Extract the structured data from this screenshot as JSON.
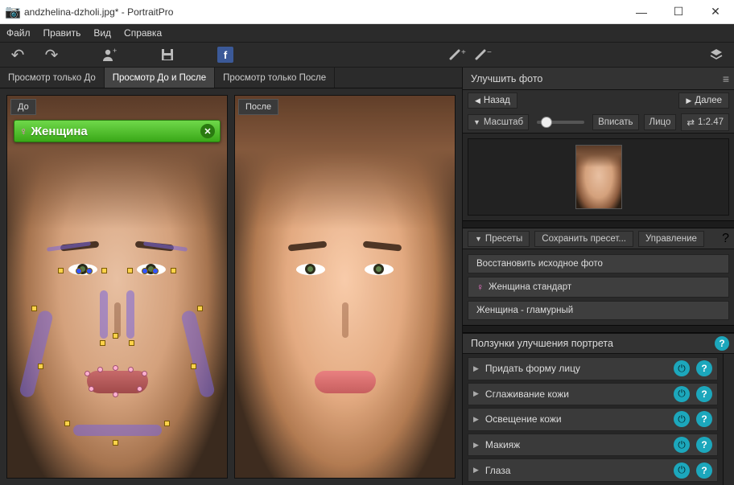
{
  "window": {
    "title": "andzhelina-dzholi.jpg* - PortraitPro"
  },
  "menu": {
    "file": "Файл",
    "edit": "Править",
    "view": "Вид",
    "help": "Справка"
  },
  "view_tabs": {
    "before_only": "Просмотр только До",
    "before_after": "Просмотр До и После",
    "after_only": "Просмотр только После"
  },
  "panes": {
    "before": "До",
    "after": "После"
  },
  "gender_tag": {
    "label": "Женщина"
  },
  "right": {
    "enhance_header": "Улучшить фото",
    "nav_back": "Назад",
    "nav_next": "Далее",
    "zoom_label": "Масштаб",
    "zoom_fit": "Вписать",
    "zoom_face": "Лицо",
    "zoom_ratio": "1:2.47",
    "presets_label": "Пресеты",
    "presets_save": "Сохранить пресет...",
    "presets_manage": "Управление",
    "preset_items": {
      "restore": "Восстановить исходное фото",
      "female_standard": "Женщина стандарт",
      "female_glamour": "Женщина - гламурный"
    },
    "sliders_header": "Ползунки улучшения портрета",
    "sliders": {
      "face_shape": "Придать форму лицу",
      "skin_smoothing": "Сглаживание кожи",
      "skin_lighting": "Освещение кожи",
      "makeup": "Макияж",
      "eyes": "Глаза"
    }
  },
  "icons": {
    "undo": "↶",
    "redo": "↷",
    "add_person": "👤",
    "save": "💾",
    "facebook": "f",
    "brush_plus": "✎+",
    "brush_minus": "✎-",
    "layers": "◈",
    "camera": "📷",
    "female": "♀",
    "close_x": "✕",
    "tri_left": "◀",
    "tri_right": "▶",
    "tri_down": "▼",
    "swap": "⇄",
    "power": "⏻",
    "question": "?",
    "minimize": "—",
    "maximize": "☐",
    "close": "✕",
    "menu": "≡"
  }
}
